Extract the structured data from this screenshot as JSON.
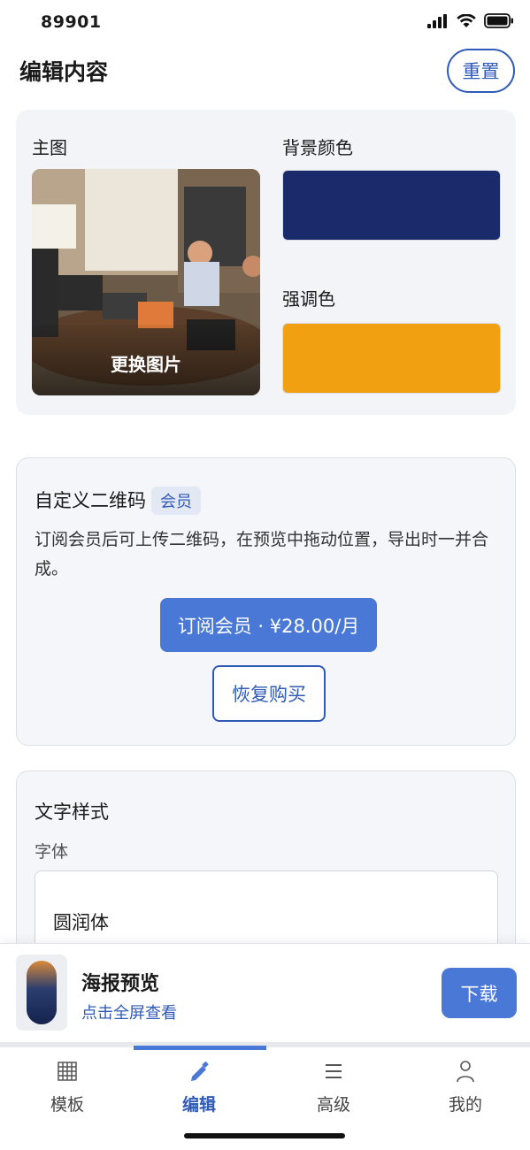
{
  "status_bar": {
    "time": "89901"
  },
  "header": {
    "title": "编辑内容",
    "reset_label": "重置"
  },
  "image_section": {
    "main_image_label": "主图",
    "change_image_label": "更换图片",
    "bg_color_label": "背景颜色",
    "bg_color": "#1b2a6b",
    "accent_color_label": "强调色",
    "accent_color": "#f0a010"
  },
  "qr_section": {
    "title": "自定义二维码",
    "badge": "会员",
    "description": "订阅会员后可上传二维码，在预览中拖动位置，导出时一并合成。",
    "subscribe_label": "订阅会员 · ¥28.00/月",
    "restore_label": "恢复购买"
  },
  "text_style_section": {
    "title": "文字样式",
    "font_label": "字体",
    "font_value": "圆润体"
  },
  "preview": {
    "title": "海报预览",
    "subtitle": "点击全屏查看",
    "download_label": "下载"
  },
  "tabs": [
    {
      "label": "模板",
      "icon": "grid-icon",
      "active": false
    },
    {
      "label": "编辑",
      "icon": "pencil-icon",
      "active": true
    },
    {
      "label": "高级",
      "icon": "menu-icon",
      "active": false
    },
    {
      "label": "我的",
      "icon": "user-icon",
      "active": false
    }
  ],
  "colors": {
    "accent_blue": "#4a78d6",
    "link_blue": "#2f5ab8"
  }
}
